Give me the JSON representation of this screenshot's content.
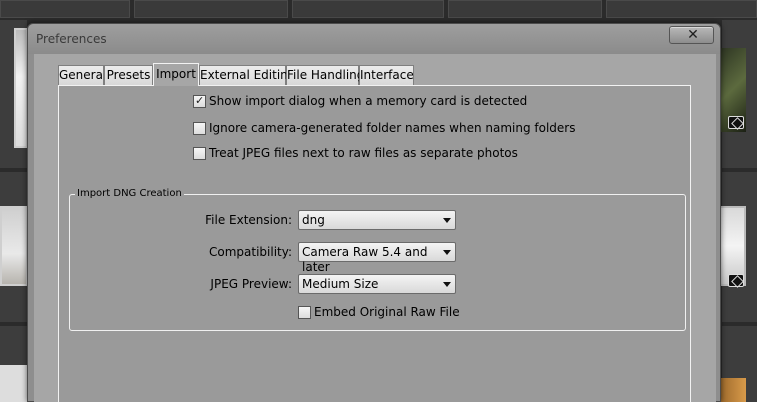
{
  "window": {
    "title": "Preferences",
    "close_icon": "close-icon"
  },
  "tabs": [
    {
      "label": "General",
      "active": false
    },
    {
      "label": "Presets",
      "active": false
    },
    {
      "label": "Import",
      "active": true
    },
    {
      "label": "External Editing",
      "active": false
    },
    {
      "label": "File Handling",
      "active": false
    },
    {
      "label": "Interface",
      "active": false
    }
  ],
  "import": {
    "options": [
      {
        "label": "Show import dialog when a memory card is detected",
        "checked": true
      },
      {
        "label": "Ignore camera-generated folder names when naming folders",
        "checked": false
      },
      {
        "label": "Treat JPEG files next to raw files as separate photos",
        "checked": false
      }
    ],
    "dng": {
      "legend": "Import DNG Creation",
      "file_extension": {
        "label": "File Extension:",
        "value": "dng"
      },
      "compatibility": {
        "label": "Compatibility:",
        "value": "Camera Raw 5.4 and later"
      },
      "jpeg_preview": {
        "label": "JPEG Preview:",
        "value": "Medium Size"
      },
      "embed_raw": {
        "label": "Embed Original Raw File",
        "checked": false
      }
    }
  },
  "colors": {
    "dialog_bg": "#8e8e8e",
    "page_bg": "#9a9a9a",
    "tab_bg": "#e4e4e4"
  }
}
